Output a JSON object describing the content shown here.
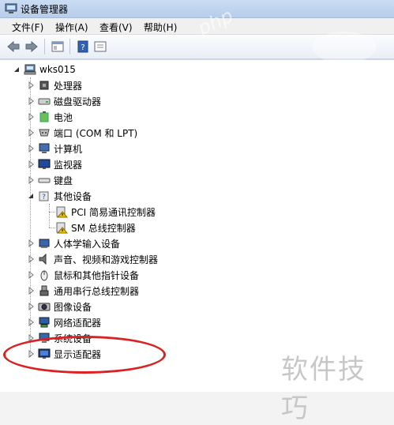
{
  "window": {
    "title": "设备管理器"
  },
  "menu": [
    "文件(F)",
    "操作(A)",
    "查看(V)",
    "帮助(H)"
  ],
  "toolbar": [
    {
      "icon": "back-arrow-icon"
    },
    {
      "icon": "forward-arrow-icon"
    },
    {
      "icon": "properties-window-icon"
    },
    {
      "icon": "help-book-icon"
    },
    {
      "icon": "show-hidden-icon"
    }
  ],
  "tree": {
    "root": "wks015",
    "items": [
      {
        "label": "处理器",
        "icon": "processor-icon",
        "expanded": false
      },
      {
        "label": "磁盘驱动器",
        "icon": "disk-drive-icon",
        "expanded": false
      },
      {
        "label": "电池",
        "icon": "battery-icon",
        "expanded": false
      },
      {
        "label": "端口 (COM 和 LPT)",
        "icon": "port-icon",
        "expanded": false
      },
      {
        "label": "计算机",
        "icon": "computer-icon",
        "expanded": false
      },
      {
        "label": "监视器",
        "icon": "monitor-icon",
        "expanded": false
      },
      {
        "label": "键盘",
        "icon": "keyboard-icon",
        "expanded": false
      },
      {
        "label": "其他设备",
        "icon": "other-devices-icon",
        "expanded": true
      },
      {
        "label": "PCI 简易通讯控制器",
        "icon": "warning-device-icon",
        "child": true
      },
      {
        "label": "SM 总线控制器",
        "icon": "warning-device-icon",
        "child": true
      },
      {
        "label": "人体学输入设备",
        "icon": "hid-icon",
        "expanded": false
      },
      {
        "label": "声音、视频和游戏控制器",
        "icon": "sound-icon",
        "expanded": false
      },
      {
        "label": "鼠标和其他指针设备",
        "icon": "mouse-icon",
        "expanded": false
      },
      {
        "label": "通用串行总线控制器",
        "icon": "usb-icon",
        "expanded": false
      },
      {
        "label": "图像设备",
        "icon": "imaging-icon",
        "expanded": false
      },
      {
        "label": "网络适配器",
        "icon": "network-icon",
        "expanded": false
      },
      {
        "label": "系统设备",
        "icon": "system-icon",
        "expanded": false
      },
      {
        "label": "显示适配器",
        "icon": "display-adapter-icon",
        "expanded": false
      }
    ]
  },
  "watermark": {
    "brand": "软件技巧",
    "site": "php"
  },
  "colors": {
    "highlight_ellipse": "#d92222"
  }
}
